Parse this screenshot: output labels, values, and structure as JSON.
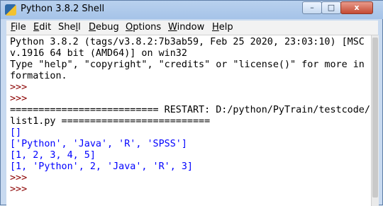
{
  "window": {
    "title": "Python 3.8.2 Shell",
    "controls": {
      "minimize": "–",
      "maximize": "□",
      "close": "x"
    }
  },
  "menu": {
    "items": [
      {
        "accel": "F",
        "rest": "ile"
      },
      {
        "accel": "E",
        "rest": "dit"
      },
      {
        "prefix": "She",
        "accel": "l",
        "rest": "l"
      },
      {
        "accel": "D",
        "rest": "ebug"
      },
      {
        "accel": "O",
        "rest": "ptions"
      },
      {
        "accel": "W",
        "rest": "indow"
      },
      {
        "accel": "H",
        "rest": "elp"
      }
    ]
  },
  "shell": {
    "banner": [
      "Python 3.8.2 (tags/v3.8.2:7b3ab59, Feb 25 2020, 23:03:10) [MSC",
      "v.1916 64 bit (AMD64)] on win32",
      "Type \"help\", \"copyright\", \"credits\" or \"license()\" for more in",
      "formation."
    ],
    "prompt": ">>>",
    "restart": [
      "========================== RESTART: D:/python/PyTrain/testcode/",
      "list1.py =========================="
    ],
    "outputs": [
      "[]",
      "['Python', 'Java', 'R', 'SPSS']",
      "[1, 2, 3, 4, 5]",
      "[1, 'Python', 2, 'Java', 'R', 3]"
    ]
  },
  "colors": {
    "prompt": "#8b0000",
    "output": "#0000ff",
    "titlebar": "#b9d1ee"
  }
}
